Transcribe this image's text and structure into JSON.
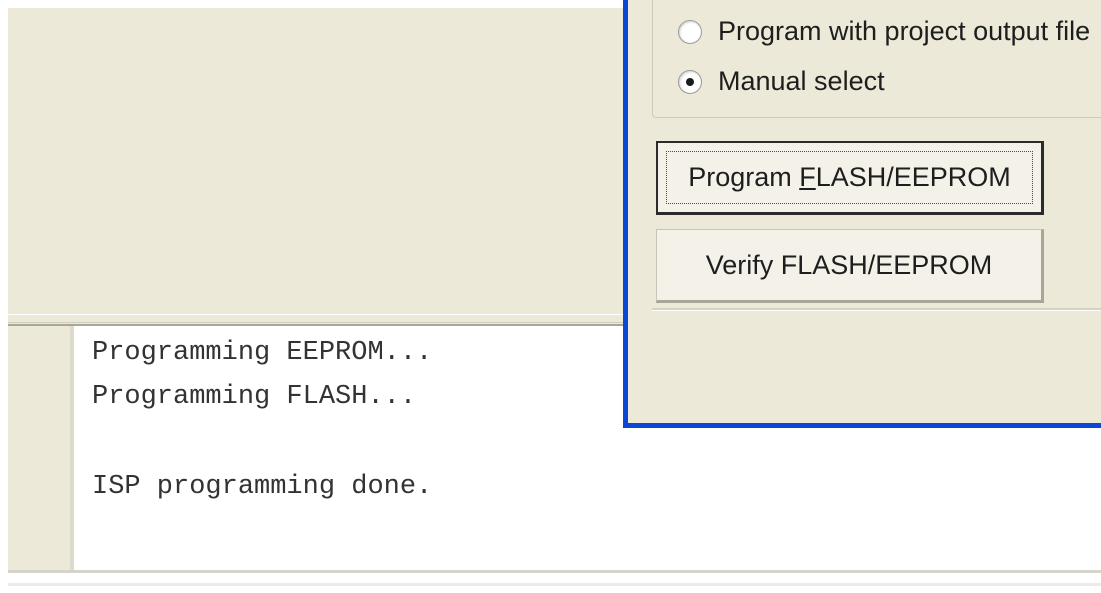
{
  "dialog": {
    "options": [
      {
        "label": "Program with project output file",
        "checked": false
      },
      {
        "label": "Manual select",
        "checked": true
      }
    ],
    "buttons": {
      "program_prefix": "Program ",
      "program_mnemonic": "F",
      "program_suffix": "LASH/EEPROM",
      "verify_label": "Verify FLASH/EEPROM"
    }
  },
  "output": {
    "lines": [
      "Programming EEPROM...",
      "Programming FLASH...",
      "",
      "ISP programming done."
    ]
  },
  "colors": {
    "window_border": "#0a47d6",
    "panel_bg": "#ece9d8"
  }
}
